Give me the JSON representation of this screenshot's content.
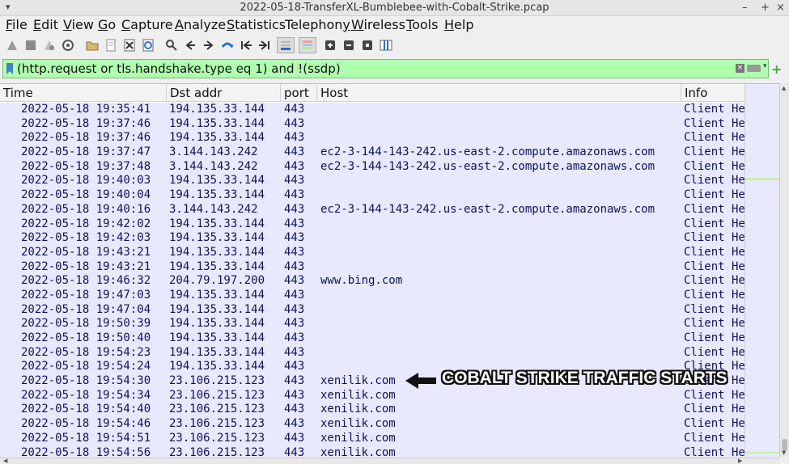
{
  "window": {
    "title": "2022-05-18-TransferXL-Bumblebee-with-Cobalt-Strike.pcap",
    "controls": {
      "minimize": "–",
      "maximize": "+",
      "close": "×"
    }
  },
  "menu": [
    {
      "id": "file",
      "label": "File"
    },
    {
      "id": "edit",
      "label": "Edit"
    },
    {
      "id": "view",
      "label": "View"
    },
    {
      "id": "go",
      "label": "Go"
    },
    {
      "id": "capture",
      "label": "Capture"
    },
    {
      "id": "analyze",
      "label": "Analyze"
    },
    {
      "id": "statistics",
      "label": "Statistics"
    },
    {
      "id": "telephony",
      "label": "Telephony"
    },
    {
      "id": "wireless",
      "label": "Wireless"
    },
    {
      "id": "tools",
      "label": "Tools"
    },
    {
      "id": "help",
      "label": "Help"
    }
  ],
  "toolbar_icons": [
    "start-capture-icon",
    "stop-capture-icon",
    "restart-capture-icon",
    "capture-options-icon",
    "open-file-icon",
    "save-file-icon",
    "close-file-icon",
    "reload-file-icon",
    "find-packet-icon",
    "go-back-icon",
    "go-forward-icon",
    "go-to-packet-icon",
    "first-packet-icon",
    "last-packet-icon",
    "autoscroll-icon",
    "colorize-icon",
    "zoom-in-icon",
    "zoom-out-icon",
    "normal-size-icon",
    "resize-columns-icon"
  ],
  "filter": {
    "value": "(http.request or tls.handshake.type eq 1) and !(ssdp)"
  },
  "columns": {
    "time": "Time",
    "dst": "Dst addr",
    "port": "port",
    "host": "Host",
    "info": "Info"
  },
  "rows": [
    {
      "time": "2022-05-18 19:35:41",
      "dst": "194.135.33.144",
      "port": "443",
      "host": "",
      "info": "Client Hello"
    },
    {
      "time": "2022-05-18 19:37:46",
      "dst": "194.135.33.144",
      "port": "443",
      "host": "",
      "info": "Client Hello"
    },
    {
      "time": "2022-05-18 19:37:46",
      "dst": "194.135.33.144",
      "port": "443",
      "host": "",
      "info": "Client Hello"
    },
    {
      "time": "2022-05-18 19:37:47",
      "dst": "3.144.143.242",
      "port": "443",
      "host": "ec2-3-144-143-242.us-east-2.compute.amazonaws.com",
      "info": "Client Hello"
    },
    {
      "time": "2022-05-18 19:37:48",
      "dst": "3.144.143.242",
      "port": "443",
      "host": "ec2-3-144-143-242.us-east-2.compute.amazonaws.com",
      "info": "Client Hello"
    },
    {
      "time": "2022-05-18 19:40:03",
      "dst": "194.135.33.144",
      "port": "443",
      "host": "",
      "info": "Client Hello"
    },
    {
      "time": "2022-05-18 19:40:04",
      "dst": "194.135.33.144",
      "port": "443",
      "host": "",
      "info": "Client Hello"
    },
    {
      "time": "2022-05-18 19:40:16",
      "dst": "3.144.143.242",
      "port": "443",
      "host": "ec2-3-144-143-242.us-east-2.compute.amazonaws.com",
      "info": "Client Hello"
    },
    {
      "time": "2022-05-18 19:42:02",
      "dst": "194.135.33.144",
      "port": "443",
      "host": "",
      "info": "Client Hello"
    },
    {
      "time": "2022-05-18 19:42:03",
      "dst": "194.135.33.144",
      "port": "443",
      "host": "",
      "info": "Client Hello"
    },
    {
      "time": "2022-05-18 19:43:21",
      "dst": "194.135.33.144",
      "port": "443",
      "host": "",
      "info": "Client Hello"
    },
    {
      "time": "2022-05-18 19:43:21",
      "dst": "194.135.33.144",
      "port": "443",
      "host": "",
      "info": "Client Hello"
    },
    {
      "time": "2022-05-18 19:46:32",
      "dst": "204.79.197.200",
      "port": "443",
      "host": "www.bing.com",
      "info": "Client Hello"
    },
    {
      "time": "2022-05-18 19:47:03",
      "dst": "194.135.33.144",
      "port": "443",
      "host": "",
      "info": "Client Hello"
    },
    {
      "time": "2022-05-18 19:47:04",
      "dst": "194.135.33.144",
      "port": "443",
      "host": "",
      "info": "Client Hello"
    },
    {
      "time": "2022-05-18 19:50:39",
      "dst": "194.135.33.144",
      "port": "443",
      "host": "",
      "info": "Client Hello"
    },
    {
      "time": "2022-05-18 19:50:40",
      "dst": "194.135.33.144",
      "port": "443",
      "host": "",
      "info": "Client Hello"
    },
    {
      "time": "2022-05-18 19:54:23",
      "dst": "194.135.33.144",
      "port": "443",
      "host": "",
      "info": "Client Hello"
    },
    {
      "time": "2022-05-18 19:54:24",
      "dst": "194.135.33.144",
      "port": "443",
      "host": "",
      "info": "Client Hello"
    },
    {
      "time": "2022-05-18 19:54:30",
      "dst": "23.106.215.123",
      "port": "443",
      "host": "xenilik.com",
      "info": "Client Hello"
    },
    {
      "time": "2022-05-18 19:54:34",
      "dst": "23.106.215.123",
      "port": "443",
      "host": "xenilik.com",
      "info": "Client Hello"
    },
    {
      "time": "2022-05-18 19:54:40",
      "dst": "23.106.215.123",
      "port": "443",
      "host": "xenilik.com",
      "info": "Client Hello"
    },
    {
      "time": "2022-05-18 19:54:46",
      "dst": "23.106.215.123",
      "port": "443",
      "host": "xenilik.com",
      "info": "Client Hello"
    },
    {
      "time": "2022-05-18 19:54:51",
      "dst": "23.106.215.123",
      "port": "443",
      "host": "xenilik.com",
      "info": "Client Hello"
    },
    {
      "time": "2022-05-18 19:54:56",
      "dst": "23.106.215.123",
      "port": "443",
      "host": "xenilik.com",
      "info": "Client Hello"
    }
  ],
  "annotation": {
    "text": "COBALT STRIKE TRAFFIC STARTS"
  },
  "colors": {
    "filter_valid_bg": "#afffaf",
    "row_bg": "#e8e8ff",
    "row_text": "#12125a"
  }
}
